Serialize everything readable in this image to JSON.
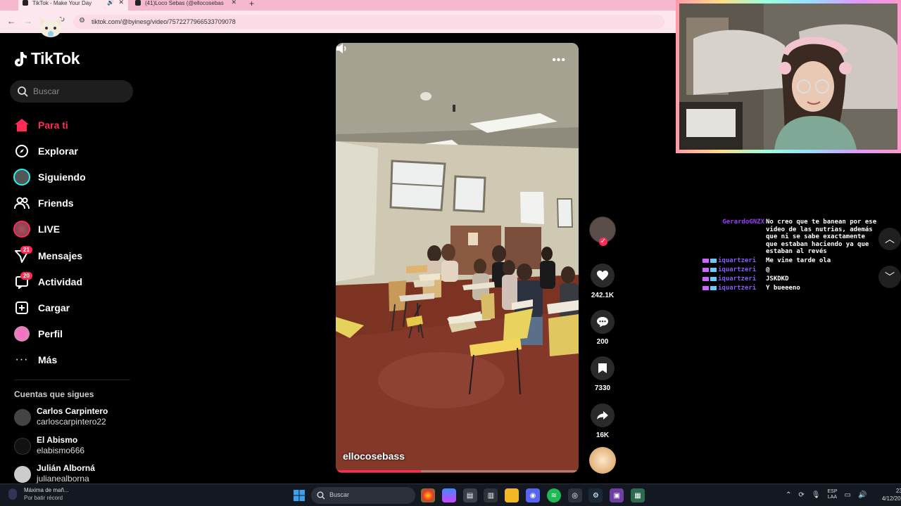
{
  "browser": {
    "tabs": [
      {
        "title": "TikTok - Make Your Day",
        "active": true
      },
      {
        "title": "(41)Loco Sebas (@ellocosebas",
        "active": false
      }
    ],
    "url": "tiktok.com/@byinesg/video/7572277966533709078"
  },
  "app": {
    "logo_text": "TikTok",
    "accent": "#fe2c55",
    "cyan": "#25f4ee"
  },
  "search": {
    "placeholder": "Buscar"
  },
  "nav": [
    {
      "label": "Para ti",
      "icon": "home-icon",
      "active": true
    },
    {
      "label": "Explorar",
      "icon": "compass-icon"
    },
    {
      "label": "Siguiendo",
      "icon": "following-avatar-icon"
    },
    {
      "label": "Friends",
      "icon": "friends-icon"
    },
    {
      "label": "LIVE",
      "icon": "live-icon"
    },
    {
      "label": "Mensajes",
      "icon": "send-icon",
      "badge": "21"
    },
    {
      "label": "Actividad",
      "icon": "inbox-icon",
      "badge": "20"
    },
    {
      "label": "Cargar",
      "icon": "upload-icon"
    },
    {
      "label": "Perfil",
      "icon": "profile-avatar-icon"
    },
    {
      "label": "Más",
      "icon": "more-icon"
    }
  ],
  "following": {
    "heading": "Cuentas que sigues",
    "accounts": [
      {
        "name": "Carlos Carpintero",
        "handle": "carloscarpintero22"
      },
      {
        "name": "El Abismo",
        "handle": "elabismo666"
      },
      {
        "name": "Julián Alborná",
        "handle": "julianealborna"
      }
    ]
  },
  "video": {
    "author": "ellocosebass",
    "progress": 0.35,
    "likes": "242.1K",
    "comments": "200",
    "saves": "7330",
    "shares": "16K"
  },
  "chat": [
    {
      "user": "GerardoGNZX",
      "message": "No creo que te banean por ese video de las nutrias, además que ni se sabe exactamente que estaban haciendo ya que estaban al revés",
      "badges": false
    },
    {
      "user": "iquartzeri",
      "message": "Me vine tarde ola",
      "badges": true
    },
    {
      "user": "iquartzeri",
      "message": "@",
      "badges": true
    },
    {
      "user": "iquartzeri",
      "message": "JSKDKD",
      "badges": true
    },
    {
      "user": "iquartzeri",
      "message": "Y bueeeno",
      "badges": true
    }
  ],
  "taskbar": {
    "weather_title": "Máxima de mañ...",
    "weather_sub": "Por batir récord",
    "search_placeholder": "Buscar",
    "lang_top": "ESP",
    "lang_bottom": "LAA",
    "time": "23:",
    "date": "4/12/202"
  }
}
